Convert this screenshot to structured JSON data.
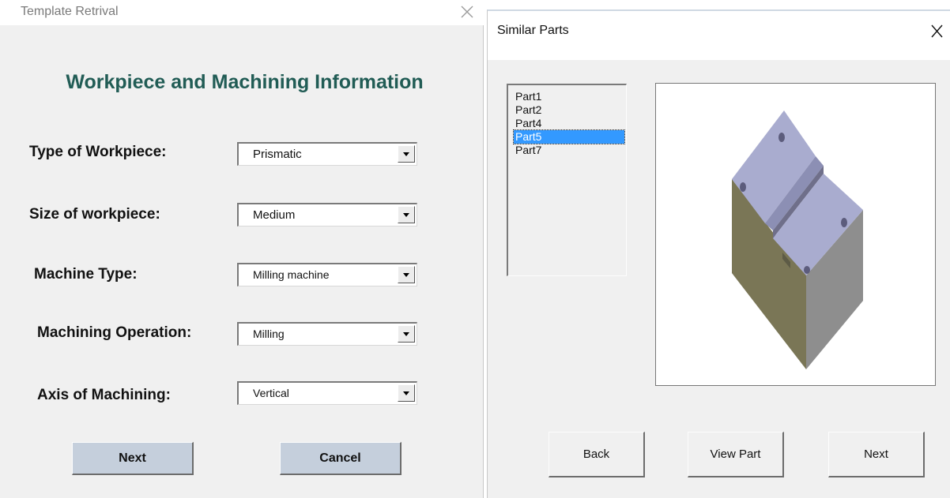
{
  "left_window": {
    "title": "Template Retrival",
    "close_icon": "close-icon",
    "heading": "Workpiece and Machining Information",
    "fields": [
      {
        "label": "Type of Workpiece:",
        "value": "Prismatic"
      },
      {
        "label": "Size of workpiece:",
        "value": "Medium"
      },
      {
        "label": "Machine Type:",
        "value": "Milling machine"
      },
      {
        "label": "Machining Operation:",
        "value": "Milling"
      },
      {
        "label": "Axis of Machining:",
        "value": "Vertical"
      }
    ],
    "next_label": "Next",
    "cancel_label": "Cancel"
  },
  "right_window": {
    "title": "Similar Parts",
    "close_label": "X",
    "parts": [
      "Part1",
      "Part2",
      "Part4",
      "Part5",
      "Part7"
    ],
    "selected_part": "Part5",
    "back_label": "Back",
    "view_part_label": "View Part",
    "next_label": "Next"
  },
  "colors": {
    "heading": "#215c55",
    "selection": "#3399ff",
    "button_face": "#c5cfdc"
  }
}
